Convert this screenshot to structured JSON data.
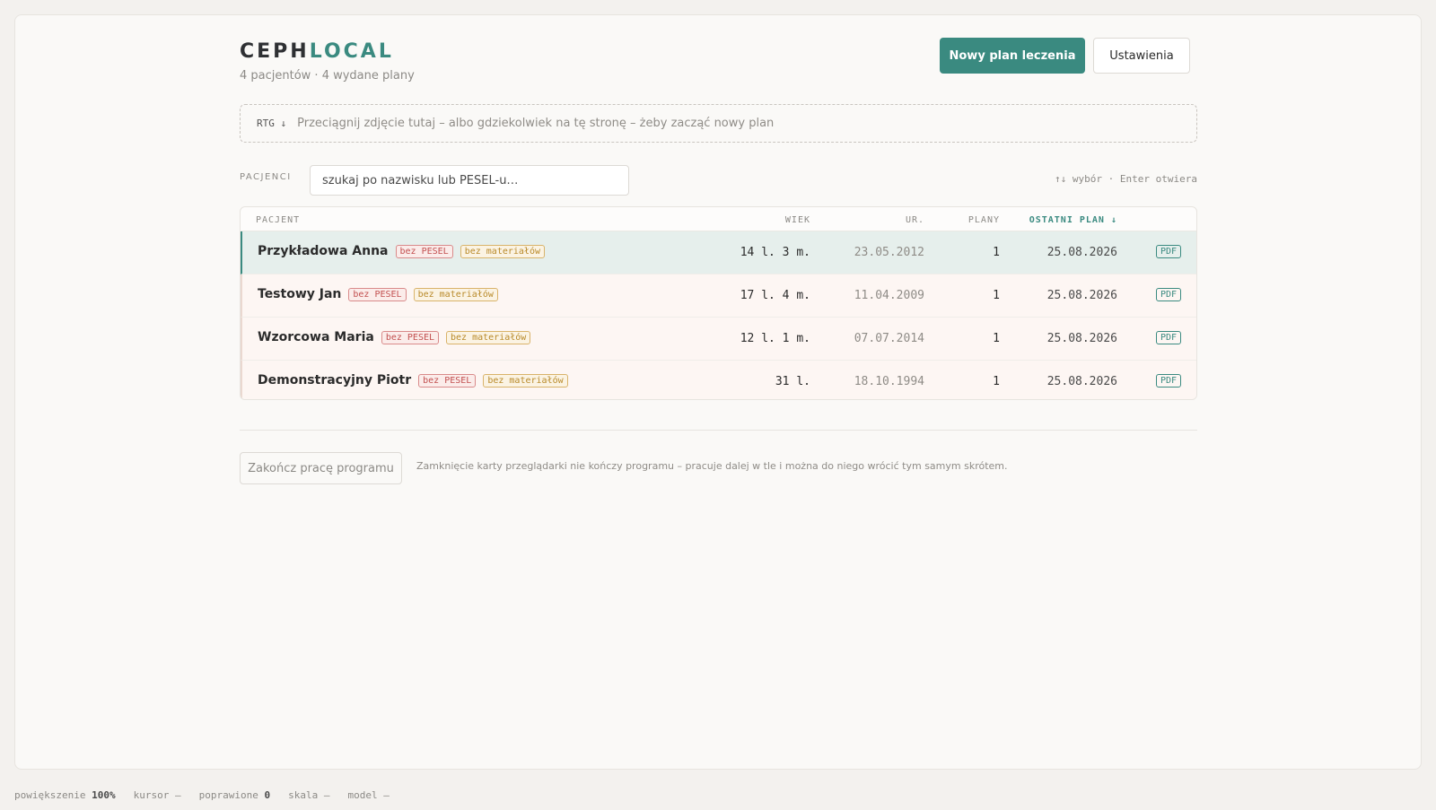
{
  "header": {
    "brand_a": "CEPH",
    "brand_b": "LOCAL",
    "subtitle": "4 pacjentów · 4 wydane plany",
    "new_plan_label": "Nowy plan leczenia",
    "settings_label": "Ustawienia"
  },
  "dropzone": {
    "tag": "RTG ↓",
    "text": "Przeciągnij zdjęcie tutaj – albo gdziekolwiek na tę stronę – żeby zacząć nowy plan"
  },
  "patients_section": {
    "label": "PACJENCI",
    "search_placeholder": "szukaj po nazwisku lub PESEL-u…",
    "hint": "↑↓ wybór · Enter otwiera"
  },
  "table": {
    "columns": {
      "patient": "PACJENT",
      "age": "WIEK",
      "dob": "UR.",
      "plans": "PLANY",
      "last_plan": "OSTATNI PLAN ↓"
    },
    "rows": [
      {
        "name": "Przykładowa Anna",
        "badge1": "bez PESEL",
        "badge2": "bez materiałów",
        "age": "14 l. 3 m.",
        "dob": "23.05.2012",
        "plans": "1",
        "last": "25.08.2026",
        "pdf": "PDF",
        "selected": true
      },
      {
        "name": "Testowy Jan",
        "badge1": "bez PESEL",
        "badge2": "bez materiałów",
        "age": "17 l. 4 m.",
        "dob": "11.04.2009",
        "plans": "1",
        "last": "25.08.2026",
        "pdf": "PDF",
        "selected": false
      },
      {
        "name": "Wzorcowa Maria",
        "badge1": "bez PESEL",
        "badge2": "bez materiałów",
        "age": "12 l. 1 m.",
        "dob": "07.07.2014",
        "plans": "1",
        "last": "25.08.2026",
        "pdf": "PDF",
        "selected": false
      },
      {
        "name": "Demonstracyjny Piotr",
        "badge1": "bez PESEL",
        "badge2": "bez materiałów",
        "age": "31 l.",
        "dob": "18.10.1994",
        "plans": "1",
        "last": "25.08.2026",
        "pdf": "PDF",
        "selected": false
      }
    ]
  },
  "footer": {
    "quit_label": "Zakończ pracę programu",
    "note": "Zamknięcie karty przeglądarki nie kończy programu – pracuje dalej w tle i można do niego wrócić tym samym skrótem."
  },
  "statusbar": {
    "zoom_label": "powiększenie",
    "zoom_value": "100%",
    "cursor_label": "kursor",
    "cursor_value": "—",
    "fixed_label": "poprawione",
    "fixed_value": "0",
    "scale_label": "skala",
    "scale_value": "—",
    "model_label": "model",
    "model_value": "—"
  },
  "colors": {
    "accent": "#3a8a80",
    "badge_red": "#c25050",
    "badge_amber": "#b98a2a"
  }
}
